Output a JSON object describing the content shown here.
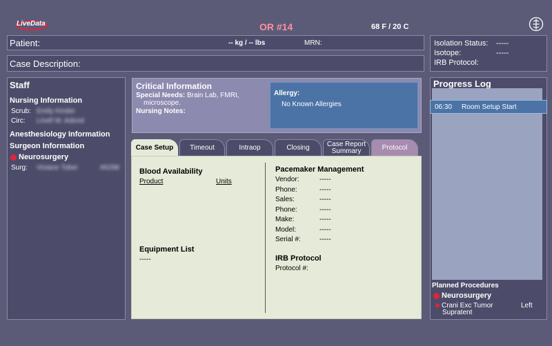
{
  "header": {
    "logo_text": "LiveData",
    "or_title": "OR #14",
    "temperature": "68  F /  20 C"
  },
  "patient_bar": {
    "label": "Patient:",
    "weight": "-- kg / -- lbs",
    "mrn_label": "MRN:"
  },
  "case_bar": {
    "label": "Case Description:"
  },
  "isolation": {
    "isolation_label": "Isolation Status:",
    "isolation_value": "-----",
    "isotope_label": "Isotope:",
    "isotope_value": "-----",
    "irb_label": "IRB Protocol:"
  },
  "staff": {
    "title": "Staff",
    "nursing_heading": "Nursing Information",
    "scrub_label": "Scrub:",
    "scrub_value": "Emily Kinder",
    "circ_label": "Circ:",
    "circ_value": "Linell W. Adond",
    "anesthesiology_heading": "Anesthesiology Information",
    "surgeon_heading": "Surgeon Information",
    "specialty": "Neurosurgery",
    "surg_label": "Surg:",
    "surg_value": "Viviane Tober",
    "surg_id": "#6298"
  },
  "critical": {
    "title": "Critical Information",
    "special_needs_label": "Special Needs:",
    "special_needs_value": "Brain Lab, FMRI,",
    "special_needs_value2": "microscope.",
    "nursing_notes_label": "Nursing Notes:",
    "allergy_label": "Allergy:",
    "allergy_value": "No Known Allergies"
  },
  "tabs": [
    {
      "label": "Case Setup"
    },
    {
      "label": "Timeout"
    },
    {
      "label": "Intraop"
    },
    {
      "label": "Closing"
    },
    {
      "label": "Case Report Summary"
    },
    {
      "label": "Protocol"
    }
  ],
  "case_setup": {
    "blood_heading": "Blood Availability",
    "product_col": "Product",
    "units_col": "Units",
    "equipment_heading": "Equipment List",
    "equipment_value": "-----",
    "pacemaker_heading": "Pacemaker Management",
    "pacemaker_rows": [
      {
        "label": "Vendor:",
        "value": "-----"
      },
      {
        "label": "Phone:",
        "value": "-----"
      },
      {
        "label": "Sales:",
        "value": "-----"
      },
      {
        "label": "Phone:",
        "value": "-----"
      },
      {
        "label": "Make:",
        "value": "-----"
      },
      {
        "label": "Model:",
        "value": "-----"
      },
      {
        "label": "Serial #:",
        "value": "-----"
      }
    ],
    "irb_heading": "IRB Protocol",
    "protocol_label": "Protocol #:"
  },
  "progress_log": {
    "title": "Progress Log",
    "entries": [
      {
        "time": "06:30",
        "event": "Room Setup Start"
      }
    ]
  },
  "planned": {
    "title": "Planned Procedures",
    "specialty": "Neurosurgery",
    "procedure_line1": "Crani Exc Tumor",
    "procedure_line2": "Supratent",
    "side": "Left"
  },
  "colors": {
    "background": "#5b5b78",
    "panel": "#4c4c6a",
    "or_title": "#ff8fa0",
    "allergy_box": "#4b73a6",
    "critical_box": "#8d8ab0",
    "content": "#e6ead8",
    "dot": "#e0253a"
  }
}
